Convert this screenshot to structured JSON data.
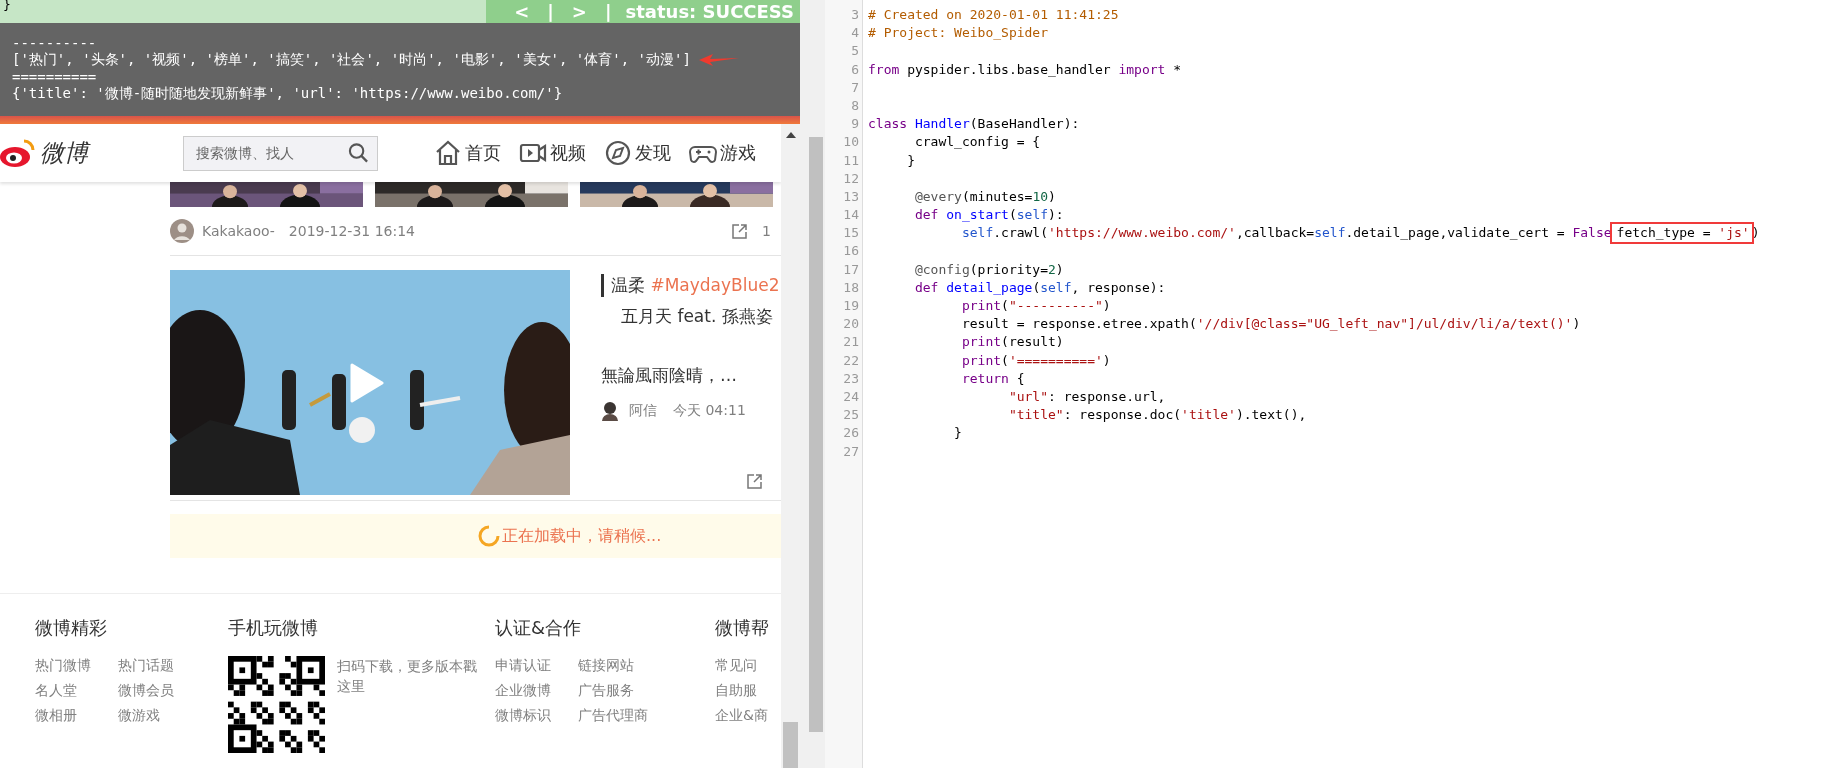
{
  "toolbar": {
    "brace": "}",
    "items": [
      {
        "kind": "button",
        "text": "<"
      },
      {
        "kind": "separator",
        "text": "|"
      },
      {
        "kind": "button",
        "text": ">"
      },
      {
        "kind": "separator",
        "text": "|"
      },
      {
        "kind": "status",
        "text": "status: SUCCESS"
      }
    ]
  },
  "console": {
    "lines": [
      {
        "text": "----------",
        "annotated": false
      },
      {
        "text": "['热门', '头条', '视频', '榜单', '搞笑', '社会', '时尚', '电影', '美女', '体育', '动漫']",
        "annotated": true
      },
      {
        "text": "==========",
        "annotated": false
      },
      {
        "text": "{'title': '微博-随时随地发现新鲜事', 'url': 'https://www.weibo.com/'}",
        "annotated": false
      }
    ]
  },
  "weibo": {
    "logo": "微博",
    "search": {
      "placeholder": "搜索微博、找人"
    },
    "nav": [
      {
        "label": "首页"
      },
      {
        "label": "视频"
      },
      {
        "label": "发现"
      },
      {
        "label": "游戏"
      }
    ],
    "post_meta": {
      "author": "Kakakaoo-",
      "time": "2019-12-31 16:14",
      "share_count": "1"
    },
    "video_post": {
      "tag_prefix": "温柔",
      "hashtag": "#MaydayBlue2",
      "subtitle": "五月天 feat. 孫燕姿",
      "excerpt": "無論風雨陰晴，…",
      "author": "阿信",
      "time": "今天 04:11"
    },
    "loading": "正在加载中，请稍候...",
    "footer": [
      {
        "kind": "links",
        "heading": "微博精彩",
        "links": [
          "热门微博",
          "热门话题",
          "名人堂",
          "微博会员",
          "微相册",
          "微游戏"
        ]
      },
      {
        "kind": "app",
        "heading": "手机玩微博",
        "text": "扫码下载，更多版本戳这里"
      },
      {
        "kind": "links",
        "heading": "认证&合作",
        "links": [
          "申请认证",
          "链接网站",
          "企业微博",
          "广告服务",
          "微博标识",
          "广告代理商"
        ]
      },
      {
        "kind": "list",
        "heading": "微博帮",
        "links": [
          "常见问",
          "自助服",
          "企业&商"
        ]
      }
    ]
  },
  "editor": {
    "lines": [
      {
        "number": "3",
        "tokens": [
          {
            "kind": "comment",
            "text": "# Created on 2020-01-01 11:41:25"
          }
        ]
      },
      {
        "number": "4",
        "tokens": [
          {
            "kind": "comment",
            "text": "# Project: Weibo_Spider"
          }
        ]
      },
      {
        "number": "5"
      },
      {
        "number": "6",
        "tokens": [
          {
            "kind": "keyword",
            "text": "from"
          },
          {
            "kind": "plain",
            "text": " pyspider.libs.base_handler "
          },
          {
            "kind": "keyword",
            "text": "import"
          },
          {
            "kind": "plain",
            "text": " *"
          }
        ]
      },
      {
        "number": "7"
      },
      {
        "number": "8"
      },
      {
        "number": "9",
        "tokens": [
          {
            "kind": "keyword",
            "text": "class "
          },
          {
            "kind": "def",
            "text": "Handler"
          },
          {
            "kind": "plain",
            "text": "(BaseHandler):"
          }
        ]
      },
      {
        "number": "10",
        "tokens": [
          {
            "kind": "plain",
            "text": "      crawl_config = {"
          }
        ]
      },
      {
        "number": "11",
        "tokens": [
          {
            "kind": "plain",
            "text": "     }"
          }
        ]
      },
      {
        "number": "12"
      },
      {
        "number": "13",
        "tokens": [
          {
            "kind": "decorator",
            "text": "      @every"
          },
          {
            "kind": "plain",
            "text": "(minutes="
          },
          {
            "kind": "number",
            "text": "10"
          },
          {
            "kind": "plain",
            "text": ")"
          }
        ]
      },
      {
        "number": "14",
        "tokens": [
          {
            "kind": "keyword",
            "text": "      def "
          },
          {
            "kind": "def",
            "text": "on_start"
          },
          {
            "kind": "plain",
            "text": "("
          },
          {
            "kind": "self",
            "text": "self"
          },
          {
            "kind": "plain",
            "text": "):"
          }
        ]
      },
      {
        "number": "15",
        "tokens": [
          {
            "kind": "self",
            "text": "            self"
          },
          {
            "kind": "plain",
            "text": ".crawl("
          },
          {
            "kind": "string",
            "text": "'https://www.weibo.com/'"
          },
          {
            "kind": "plain",
            "text": ",callback="
          },
          {
            "kind": "self",
            "text": "self"
          },
          {
            "kind": "plain",
            "text": ".detail_page,validate_cert = "
          },
          {
            "kind": "keyword",
            "text": "False"
          }
        ],
        "boxed": [
          {
            "kind": "plain",
            "text": "fetch_type = "
          },
          {
            "kind": "string",
            "text": "'js'"
          }
        ],
        "tail": ")"
      },
      {
        "number": "16"
      },
      {
        "number": "17",
        "tokens": [
          {
            "kind": "decorator",
            "text": "      @config"
          },
          {
            "kind": "plain",
            "text": "(priority="
          },
          {
            "kind": "number",
            "text": "2"
          },
          {
            "kind": "plain",
            "text": ")"
          }
        ]
      },
      {
        "number": "18",
        "tokens": [
          {
            "kind": "keyword",
            "text": "      def "
          },
          {
            "kind": "def",
            "text": "detail_page"
          },
          {
            "kind": "plain",
            "text": "("
          },
          {
            "kind": "self",
            "text": "self"
          },
          {
            "kind": "plain",
            "text": ", response):"
          }
        ]
      },
      {
        "number": "19",
        "tokens": [
          {
            "kind": "builtin",
            "text": "            print"
          },
          {
            "kind": "plain",
            "text": "("
          },
          {
            "kind": "string",
            "text": "\"----------\""
          },
          {
            "kind": "plain",
            "text": ")"
          }
        ]
      },
      {
        "number": "20",
        "tokens": [
          {
            "kind": "plain",
            "text": "            result = response.etree.xpath("
          },
          {
            "kind": "string",
            "text": "'//div[@class=\"UG_left_nav\"]/ul/div/li/a/text()'"
          },
          {
            "kind": "plain",
            "text": ")"
          }
        ]
      },
      {
        "number": "21",
        "tokens": [
          {
            "kind": "builtin",
            "text": "            print"
          },
          {
            "kind": "plain",
            "text": "(result)"
          }
        ]
      },
      {
        "number": "22",
        "tokens": [
          {
            "kind": "builtin",
            "text": "            print"
          },
          {
            "kind": "plain",
            "text": "("
          },
          {
            "kind": "string",
            "text": "'=========='"
          },
          {
            "kind": "plain",
            "text": ")"
          }
        ]
      },
      {
        "number": "23",
        "tokens": [
          {
            "kind": "keyword",
            "text": "            return"
          },
          {
            "kind": "plain",
            "text": " {"
          }
        ]
      },
      {
        "number": "24",
        "tokens": [
          {
            "kind": "string",
            "text": "                  \"url\""
          },
          {
            "kind": "plain",
            "text": ": response.url,"
          }
        ]
      },
      {
        "number": "25",
        "tokens": [
          {
            "kind": "string",
            "text": "                  \"title\""
          },
          {
            "kind": "plain",
            "text": ": response.doc("
          },
          {
            "kind": "string",
            "text": "'title'"
          },
          {
            "kind": "plain",
            "text": ").text(),"
          }
        ]
      },
      {
        "number": "26",
        "tokens": [
          {
            "kind": "plain",
            "text": "           }"
          }
        ]
      },
      {
        "number": "27"
      }
    ]
  }
}
